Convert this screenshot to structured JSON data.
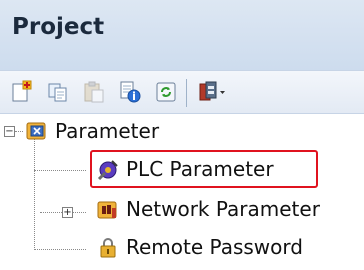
{
  "panel": {
    "title": "Project"
  },
  "toolbar": {
    "buttons": [
      {
        "icon": "new-item-icon"
      },
      {
        "icon": "copy-icon"
      },
      {
        "icon": "paste-icon"
      },
      {
        "icon": "properties-icon"
      },
      {
        "icon": "refresh-icon"
      },
      {
        "icon": "filter-dropdown-icon"
      }
    ]
  },
  "tree": {
    "root": {
      "label": "Parameter",
      "expanded": true
    },
    "children": [
      {
        "label": "PLC Parameter",
        "selected": true
      },
      {
        "label": "Network Parameter",
        "expanded": false
      },
      {
        "label": "Remote Password"
      }
    ]
  },
  "colors": {
    "highlight": "#e0131f",
    "title_bg": "#cddcee"
  }
}
